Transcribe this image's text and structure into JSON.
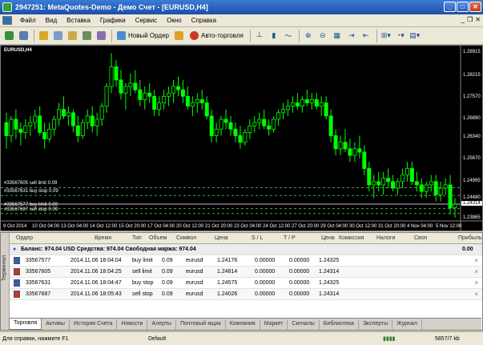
{
  "titlebar": {
    "title": "2947251: MetaQuotes-Demo - Демо Счет - [EURUSD,H4]"
  },
  "menu": [
    "Файл",
    "Вид",
    "Вставка",
    "Графики",
    "Сервис",
    "Окно",
    "Справка"
  ],
  "toolbar": {
    "new_order": "Новый Ордер",
    "autotrading": "Авто-торговля"
  },
  "chart": {
    "symbol_label": "EURUSD,H4",
    "price_labels": [
      "1.28915",
      "1.28215",
      "1.27570",
      "1.26890",
      "1.26340",
      "1.25670",
      "1.24995",
      "1.24480",
      "1.24314",
      "1.23865"
    ],
    "current_price": "1.24314",
    "time_labels": [
      "9 Oct 2014",
      "10 Oct 04:00",
      "13 Oct 04:00",
      "14 Oct 12:00",
      "15 Oct 20:00",
      "17 Oct 04:00",
      "20 Oct 12:00",
      "21 Oct 20:00",
      "23 Oct 04:00",
      "24 Oct 12:00",
      "27 Oct 20:00",
      "29 Oct 04:00",
      "30 Oct 12:00",
      "31 Oct 20:00",
      "4 Nov 04:00",
      "5 Nov 12:00"
    ],
    "order_labels": [
      "#33567605 sell limit 0.09",
      "#33567631 buy stop 0.09",
      "#33567577 buy limit 0.09",
      "#33567687 sell stop 0.09"
    ],
    "candles": [
      [
        1.268,
        1.271,
        1.26,
        1.264
      ],
      [
        1.264,
        1.27,
        1.262,
        1.269
      ],
      [
        1.269,
        1.272,
        1.263,
        1.266
      ],
      [
        1.266,
        1.268,
        1.261,
        1.265
      ],
      [
        1.265,
        1.269,
        1.263,
        1.267
      ],
      [
        1.267,
        1.27,
        1.264,
        1.268
      ],
      [
        1.268,
        1.272,
        1.266,
        1.27
      ],
      [
        1.27,
        1.273,
        1.264,
        1.265
      ],
      [
        1.265,
        1.268,
        1.26,
        1.263
      ],
      [
        1.263,
        1.268,
        1.262,
        1.266
      ],
      [
        1.266,
        1.27,
        1.264,
        1.269
      ],
      [
        1.269,
        1.274,
        1.267,
        1.272
      ],
      [
        1.272,
        1.276,
        1.269,
        1.27
      ],
      [
        1.27,
        1.273,
        1.267,
        1.271
      ],
      [
        1.271,
        1.272,
        1.265,
        1.267
      ],
      [
        1.267,
        1.27,
        1.262,
        1.264
      ],
      [
        1.264,
        1.269,
        1.263,
        1.268
      ],
      [
        1.268,
        1.272,
        1.266,
        1.27
      ],
      [
        1.27,
        1.273,
        1.265,
        1.267
      ],
      [
        1.267,
        1.271,
        1.264,
        1.269
      ],
      [
        1.269,
        1.274,
        1.267,
        1.273
      ],
      [
        1.273,
        1.28,
        1.271,
        1.279
      ],
      [
        1.279,
        1.2892,
        1.277,
        1.285
      ],
      [
        1.285,
        1.287,
        1.279,
        1.281
      ],
      [
        1.281,
        1.284,
        1.275,
        1.277
      ],
      [
        1.277,
        1.28,
        1.272,
        1.279
      ],
      [
        1.279,
        1.283,
        1.276,
        1.28
      ],
      [
        1.28,
        1.284,
        1.277,
        1.278
      ],
      [
        1.278,
        1.281,
        1.273,
        1.275
      ],
      [
        1.275,
        1.279,
        1.272,
        1.277
      ],
      [
        1.277,
        1.28,
        1.274,
        1.276
      ],
      [
        1.276,
        1.278,
        1.27,
        1.272
      ],
      [
        1.272,
        1.276,
        1.27,
        1.274
      ],
      [
        1.274,
        1.278,
        1.272,
        1.276
      ],
      [
        1.276,
        1.279,
        1.273,
        1.277
      ],
      [
        1.277,
        1.281,
        1.274,
        1.279
      ],
      [
        1.279,
        1.282,
        1.276,
        1.278
      ],
      [
        1.278,
        1.281,
        1.274,
        1.276
      ],
      [
        1.276,
        1.279,
        1.272,
        1.273
      ],
      [
        1.273,
        1.276,
        1.27,
        1.274
      ],
      [
        1.274,
        1.277,
        1.271,
        1.275
      ],
      [
        1.275,
        1.278,
        1.272,
        1.274
      ],
      [
        1.274,
        1.276,
        1.269,
        1.27
      ],
      [
        1.27,
        1.272,
        1.262,
        1.264
      ],
      [
        1.264,
        1.268,
        1.262,
        1.266
      ],
      [
        1.266,
        1.27,
        1.264,
        1.269
      ],
      [
        1.269,
        1.272,
        1.266,
        1.268
      ],
      [
        1.268,
        1.27,
        1.264,
        1.266
      ],
      [
        1.266,
        1.268,
        1.262,
        1.264
      ],
      [
        1.264,
        1.267,
        1.26,
        1.262
      ],
      [
        1.262,
        1.266,
        1.261,
        1.265
      ],
      [
        1.265,
        1.269,
        1.263,
        1.267
      ],
      [
        1.267,
        1.27,
        1.265,
        1.268
      ],
      [
        1.268,
        1.271,
        1.266,
        1.269
      ],
      [
        1.269,
        1.272,
        1.266,
        1.267
      ],
      [
        1.267,
        1.269,
        1.264,
        1.266
      ],
      [
        1.266,
        1.27,
        1.265,
        1.269
      ],
      [
        1.269,
        1.272,
        1.267,
        1.271
      ],
      [
        1.271,
        1.274,
        1.269,
        1.272
      ],
      [
        1.272,
        1.275,
        1.27,
        1.273
      ],
      [
        1.273,
        1.276,
        1.271,
        1.274
      ],
      [
        1.274,
        1.277,
        1.272,
        1.273
      ],
      [
        1.273,
        1.276,
        1.271,
        1.275
      ],
      [
        1.275,
        1.278,
        1.273,
        1.274
      ],
      [
        1.274,
        1.277,
        1.272,
        1.275
      ],
      [
        1.275,
        1.277,
        1.272,
        1.273
      ],
      [
        1.273,
        1.276,
        1.27,
        1.274
      ],
      [
        1.274,
        1.276,
        1.269,
        1.27
      ],
      [
        1.27,
        1.272,
        1.262,
        1.264
      ],
      [
        1.264,
        1.266,
        1.258,
        1.26
      ],
      [
        1.26,
        1.264,
        1.258,
        1.262
      ],
      [
        1.262,
        1.266,
        1.259,
        1.26
      ],
      [
        1.26,
        1.263,
        1.256,
        1.258
      ],
      [
        1.258,
        1.262,
        1.256,
        1.26
      ],
      [
        1.26,
        1.264,
        1.257,
        1.259
      ],
      [
        1.259,
        1.261,
        1.252,
        1.254
      ],
      [
        1.254,
        1.256,
        1.247,
        1.249
      ],
      [
        1.249,
        1.252,
        1.245,
        1.25
      ],
      [
        1.25,
        1.253,
        1.247,
        1.249
      ],
      [
        1.249,
        1.253,
        1.246,
        1.251
      ],
      [
        1.251,
        1.254,
        1.248,
        1.25
      ],
      [
        1.25,
        1.252,
        1.247,
        1.248
      ],
      [
        1.248,
        1.251,
        1.246,
        1.25
      ],
      [
        1.25,
        1.254,
        1.248,
        1.252
      ],
      [
        1.252,
        1.256,
        1.25,
        1.254
      ],
      [
        1.254,
        1.256,
        1.249,
        1.25
      ],
      [
        1.25,
        1.253,
        1.247,
        1.249
      ],
      [
        1.249,
        1.251,
        1.245,
        1.247
      ],
      [
        1.247,
        1.25,
        1.245,
        1.249
      ],
      [
        1.249,
        1.252,
        1.247,
        1.25
      ],
      [
        1.25,
        1.252,
        1.244,
        1.246
      ],
      [
        1.246,
        1.25,
        1.244,
        1.248
      ],
      [
        1.248,
        1.251,
        1.246,
        1.249
      ],
      [
        1.249,
        1.252,
        1.24,
        1.242
      ],
      [
        1.242,
        1.245,
        1.239,
        1.2431
      ]
    ]
  },
  "terminal": {
    "side_label": "Терминал",
    "headers": {
      "order": "Ордер",
      "time": "Время",
      "type": "Тип",
      "volume": "Объем",
      "symbol": "Символ",
      "price": "Цена",
      "sl": "S / L",
      "tp": "T / P",
      "cur_price": "Цена",
      "commission": "Комиссия",
      "taxes": "Налоги",
      "swap": "Своп",
      "profit": "Прибыль"
    },
    "balance_text": "Баланс: 974.04 USD  Средства: 974.04  Свободная маржа: 974.04",
    "balance_profit": "0.00",
    "orders": [
      {
        "order": "33567577",
        "time": "2014.11.06 18:04:04",
        "type": "buy limit",
        "volume": "0.09",
        "symbol": "eurusd",
        "price": "1.24176",
        "sl": "0.00000",
        "tp": "0.00000",
        "cur_price": "1.24325",
        "icon_color": "#2a5fbf"
      },
      {
        "order": "33567605",
        "time": "2014.11.06 18:04:25",
        "type": "sell limit",
        "volume": "0.09",
        "symbol": "eurusd",
        "price": "1.24814",
        "sl": "0.00000",
        "tp": "0.00000",
        "cur_price": "1.24314",
        "icon_color": "#c0392b"
      },
      {
        "order": "33567631",
        "time": "2014.11.06 18:04:47",
        "type": "buy stop",
        "volume": "0.09",
        "symbol": "eurusd",
        "price": "1.24575",
        "sl": "0.00000",
        "tp": "0.00000",
        "cur_price": "1.24325",
        "icon_color": "#2a5fbf"
      },
      {
        "order": "33567687",
        "time": "2014.11.06 18:05:43",
        "type": "sell stop",
        "volume": "0.09",
        "symbol": "eurusd",
        "price": "1.24026",
        "sl": "0.00000",
        "tp": "0.00000",
        "cur_price": "1.24314",
        "icon_color": "#c0392b"
      }
    ],
    "remove_glyph": "×",
    "tabs": [
      "Торговля",
      "Активы",
      "История Счета",
      "Новости",
      "Алерты",
      "Почтовый ящик",
      "Компания",
      "Маркет",
      "Сигналы",
      "Библиотека",
      "Эксперты",
      "Журнал"
    ]
  },
  "status": {
    "help": "Для справки, нажмите F1",
    "profile": "Default",
    "traffic": "5857/7 kb"
  },
  "colors": {
    "bull": "#00ff00",
    "bear": "#00ff00",
    "grid": "#3a3a3a",
    "order_line": "#3fa83f",
    "bid_line": "#c0c0c0"
  }
}
